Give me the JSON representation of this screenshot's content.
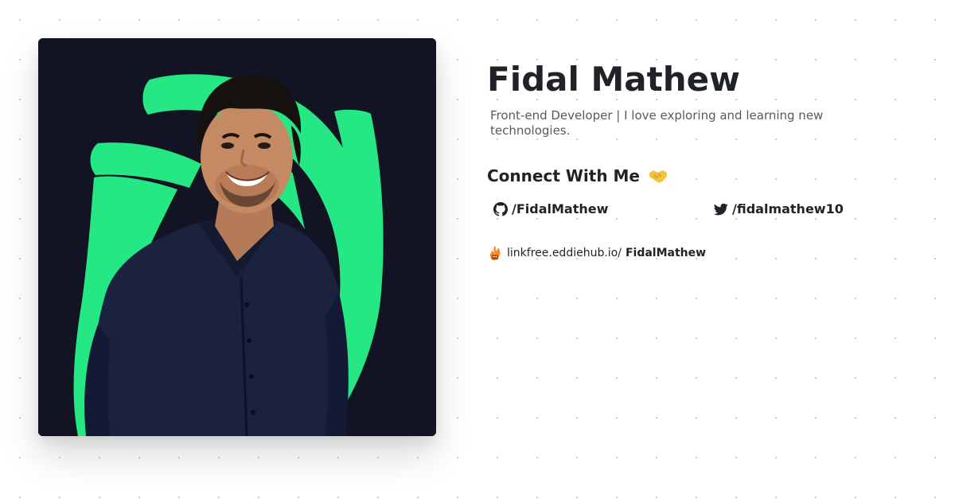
{
  "profile": {
    "name": "Fidal Mathew",
    "bio": "Front-end Developer | I love exploring and learning new technologies."
  },
  "connect": {
    "heading": "Connect With Me",
    "emoji": "🤝"
  },
  "socials": [
    {
      "platform": "GitHub",
      "icon": "github-icon",
      "handle": "/FidalMathew"
    },
    {
      "platform": "Twitter",
      "icon": "twitter-icon",
      "handle": "/fidalmathew10"
    }
  ],
  "footer": {
    "logo": "linkfree-logo-icon",
    "host": "linkfree.eddiehub.io/",
    "username": "FidalMathew"
  },
  "colors": {
    "accent_green": "#25e884",
    "card_background": "#121423",
    "text": "#1f2328",
    "muted_text": "#555a60"
  }
}
